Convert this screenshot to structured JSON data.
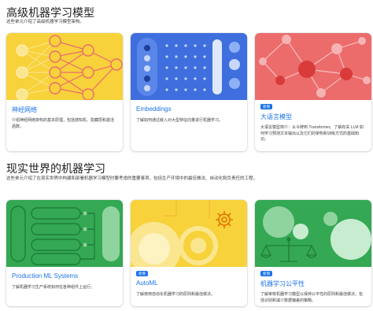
{
  "sections": [
    {
      "title": "高级机器学习模型",
      "description": "这些单元介绍了高级机器学习模型架构。",
      "cards": [
        {
          "title": "神经网络",
          "description": "介绍神经网络架构的基本原理，包括感知机、隐藏层和激活函数。",
          "badge": ""
        },
        {
          "title": "Embeddings",
          "description": "了解如何通过嵌入对大型特征向量进行机器学习。",
          "badge": ""
        },
        {
          "title": "大语言模型",
          "description": "大语言模型简介：从令牌到 Transformer。了解有关 LLM 如何学习预测文本输出以及它们的架构和训练方式的基础知识。",
          "badge": "新增"
        }
      ]
    },
    {
      "title": "现实世界的机器学习",
      "description": "这些单元介绍了在现实世界中构建和部署机器学习模型时要考虑的重要事项，包括生产环境中的最佳做法、自动化和负责任的工程。",
      "cards": [
        {
          "title": "Production ML Systems",
          "description": "了解机器学习生产系统如何在各种组件上运行。",
          "badge": ""
        },
        {
          "title": "AutoML",
          "description": "了解使用自动化机器学习的原则和最佳做法。",
          "badge": "新增"
        },
        {
          "title": "机器学习公平性",
          "description": "了解审核机器学习模型以保持公平性的原则和最佳做法，包括识别和减少数据偏差的策略。",
          "badge": "新增"
        }
      ]
    }
  ],
  "colors": {
    "yellow": "#f8d23b",
    "blue": "#3f6fde",
    "red": "#ec6b6b",
    "green": "#34a853",
    "link": "#1a73e8"
  },
  "icons": [
    "gear-icon",
    "balance-scale-icon"
  ]
}
